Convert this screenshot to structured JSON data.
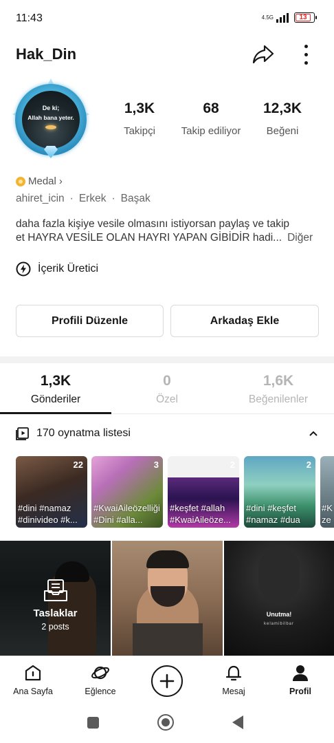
{
  "status_bar": {
    "time": "11:43",
    "network": "4.5G",
    "battery": "13"
  },
  "profile": {
    "username": "Hak_Din",
    "avatar_text_line1": "De ki;",
    "avatar_text_line2": "Allah bana yeter.",
    "stats": [
      {
        "value": "1,3K",
        "label": "Takipçi"
      },
      {
        "value": "68",
        "label": "Takip ediliyor"
      },
      {
        "value": "12,3K",
        "label": "Beğeni"
      }
    ],
    "medal_label": "Medal",
    "medal_chevron": "›",
    "info": [
      "ahiret_icin",
      "·",
      "Erkek",
      "·",
      "Başak"
    ],
    "bio_line1": "daha fazla kişiye vesile olmasını istiyorsan paylaş ve takip",
    "bio_line2": "et HAYRA VESİLE OLAN HAYRI YAPAN GİBİDİR hadi...",
    "bio_more": "Diğer",
    "creator_label": "İçerik Üretici",
    "edit_button": "Profili Düzenle",
    "add_friend_button": "Arkadaş Ekle"
  },
  "tabs": [
    {
      "count": "1,3K",
      "label": "Gönderiler"
    },
    {
      "count": "0",
      "label": "Özel"
    },
    {
      "count": "1,6K",
      "label": "Beğenilenler"
    }
  ],
  "playlists": {
    "header": "170 oynatma listesi",
    "items": [
      {
        "count": "22",
        "caption": "#dini #namaz #dinivideo #k..."
      },
      {
        "count": "3",
        "caption": "#KwaiAileözelliği #Dini #alla..."
      },
      {
        "count": "2",
        "caption": "#keşfet #allah #KwaiAileöze..."
      },
      {
        "count": "2",
        "caption": "#dini #keşfet #namaz #dua"
      },
      {
        "count": "",
        "caption": "#K ze"
      }
    ]
  },
  "posts": {
    "drafts_title": "Taslaklar",
    "drafts_sub": "2 posts",
    "post3_title": "Unutma!",
    "post3_sub": "kelamibilbar"
  },
  "bottom_nav": [
    {
      "label": "Ana Sayfa"
    },
    {
      "label": "Eğlence"
    },
    {
      "label": "Mesaj"
    },
    {
      "label": "Profil"
    }
  ],
  "colors": {
    "battery_low": "#e32b2b",
    "medal": "#f3b431",
    "avatar_frame": "#5cc6ee"
  },
  "icons": [
    "share-icon",
    "more-icon",
    "bolt-icon",
    "playlist-icon",
    "chevron-up-icon",
    "drafts-icon",
    "home-icon",
    "planet-icon",
    "add-icon",
    "bell-icon",
    "profile-icon"
  ]
}
